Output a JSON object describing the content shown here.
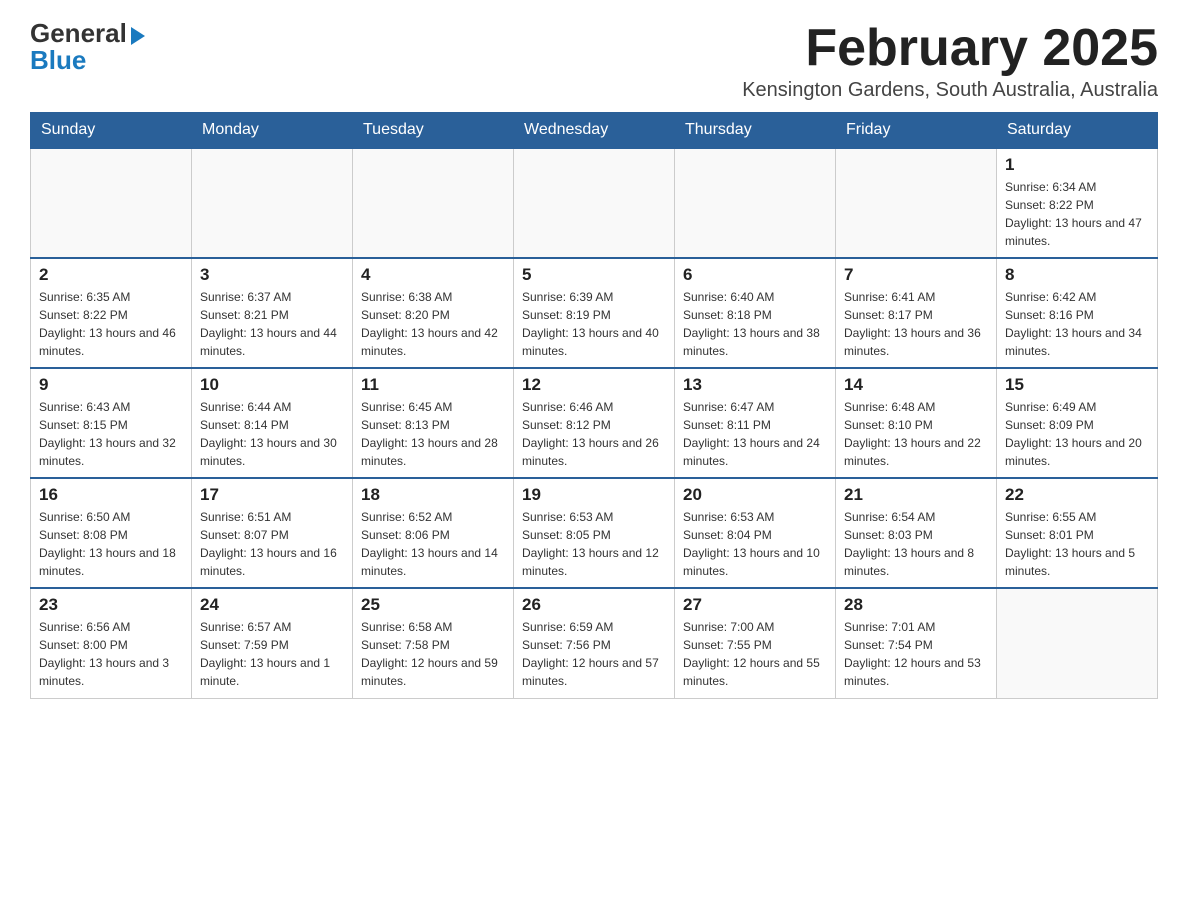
{
  "header": {
    "logo_general": "General",
    "logo_blue": "Blue",
    "month_title": "February 2025",
    "location": "Kensington Gardens, South Australia, Australia"
  },
  "days_of_week": [
    "Sunday",
    "Monday",
    "Tuesday",
    "Wednesday",
    "Thursday",
    "Friday",
    "Saturday"
  ],
  "weeks": [
    [
      {
        "day": "",
        "info": ""
      },
      {
        "day": "",
        "info": ""
      },
      {
        "day": "",
        "info": ""
      },
      {
        "day": "",
        "info": ""
      },
      {
        "day": "",
        "info": ""
      },
      {
        "day": "",
        "info": ""
      },
      {
        "day": "1",
        "info": "Sunrise: 6:34 AM\nSunset: 8:22 PM\nDaylight: 13 hours and 47 minutes."
      }
    ],
    [
      {
        "day": "2",
        "info": "Sunrise: 6:35 AM\nSunset: 8:22 PM\nDaylight: 13 hours and 46 minutes."
      },
      {
        "day": "3",
        "info": "Sunrise: 6:37 AM\nSunset: 8:21 PM\nDaylight: 13 hours and 44 minutes."
      },
      {
        "day": "4",
        "info": "Sunrise: 6:38 AM\nSunset: 8:20 PM\nDaylight: 13 hours and 42 minutes."
      },
      {
        "day": "5",
        "info": "Sunrise: 6:39 AM\nSunset: 8:19 PM\nDaylight: 13 hours and 40 minutes."
      },
      {
        "day": "6",
        "info": "Sunrise: 6:40 AM\nSunset: 8:18 PM\nDaylight: 13 hours and 38 minutes."
      },
      {
        "day": "7",
        "info": "Sunrise: 6:41 AM\nSunset: 8:17 PM\nDaylight: 13 hours and 36 minutes."
      },
      {
        "day": "8",
        "info": "Sunrise: 6:42 AM\nSunset: 8:16 PM\nDaylight: 13 hours and 34 minutes."
      }
    ],
    [
      {
        "day": "9",
        "info": "Sunrise: 6:43 AM\nSunset: 8:15 PM\nDaylight: 13 hours and 32 minutes."
      },
      {
        "day": "10",
        "info": "Sunrise: 6:44 AM\nSunset: 8:14 PM\nDaylight: 13 hours and 30 minutes."
      },
      {
        "day": "11",
        "info": "Sunrise: 6:45 AM\nSunset: 8:13 PM\nDaylight: 13 hours and 28 minutes."
      },
      {
        "day": "12",
        "info": "Sunrise: 6:46 AM\nSunset: 8:12 PM\nDaylight: 13 hours and 26 minutes."
      },
      {
        "day": "13",
        "info": "Sunrise: 6:47 AM\nSunset: 8:11 PM\nDaylight: 13 hours and 24 minutes."
      },
      {
        "day": "14",
        "info": "Sunrise: 6:48 AM\nSunset: 8:10 PM\nDaylight: 13 hours and 22 minutes."
      },
      {
        "day": "15",
        "info": "Sunrise: 6:49 AM\nSunset: 8:09 PM\nDaylight: 13 hours and 20 minutes."
      }
    ],
    [
      {
        "day": "16",
        "info": "Sunrise: 6:50 AM\nSunset: 8:08 PM\nDaylight: 13 hours and 18 minutes."
      },
      {
        "day": "17",
        "info": "Sunrise: 6:51 AM\nSunset: 8:07 PM\nDaylight: 13 hours and 16 minutes."
      },
      {
        "day": "18",
        "info": "Sunrise: 6:52 AM\nSunset: 8:06 PM\nDaylight: 13 hours and 14 minutes."
      },
      {
        "day": "19",
        "info": "Sunrise: 6:53 AM\nSunset: 8:05 PM\nDaylight: 13 hours and 12 minutes."
      },
      {
        "day": "20",
        "info": "Sunrise: 6:53 AM\nSunset: 8:04 PM\nDaylight: 13 hours and 10 minutes."
      },
      {
        "day": "21",
        "info": "Sunrise: 6:54 AM\nSunset: 8:03 PM\nDaylight: 13 hours and 8 minutes."
      },
      {
        "day": "22",
        "info": "Sunrise: 6:55 AM\nSunset: 8:01 PM\nDaylight: 13 hours and 5 minutes."
      }
    ],
    [
      {
        "day": "23",
        "info": "Sunrise: 6:56 AM\nSunset: 8:00 PM\nDaylight: 13 hours and 3 minutes."
      },
      {
        "day": "24",
        "info": "Sunrise: 6:57 AM\nSunset: 7:59 PM\nDaylight: 13 hours and 1 minute."
      },
      {
        "day": "25",
        "info": "Sunrise: 6:58 AM\nSunset: 7:58 PM\nDaylight: 12 hours and 59 minutes."
      },
      {
        "day": "26",
        "info": "Sunrise: 6:59 AM\nSunset: 7:56 PM\nDaylight: 12 hours and 57 minutes."
      },
      {
        "day": "27",
        "info": "Sunrise: 7:00 AM\nSunset: 7:55 PM\nDaylight: 12 hours and 55 minutes."
      },
      {
        "day": "28",
        "info": "Sunrise: 7:01 AM\nSunset: 7:54 PM\nDaylight: 12 hours and 53 minutes."
      },
      {
        "day": "",
        "info": ""
      }
    ]
  ]
}
